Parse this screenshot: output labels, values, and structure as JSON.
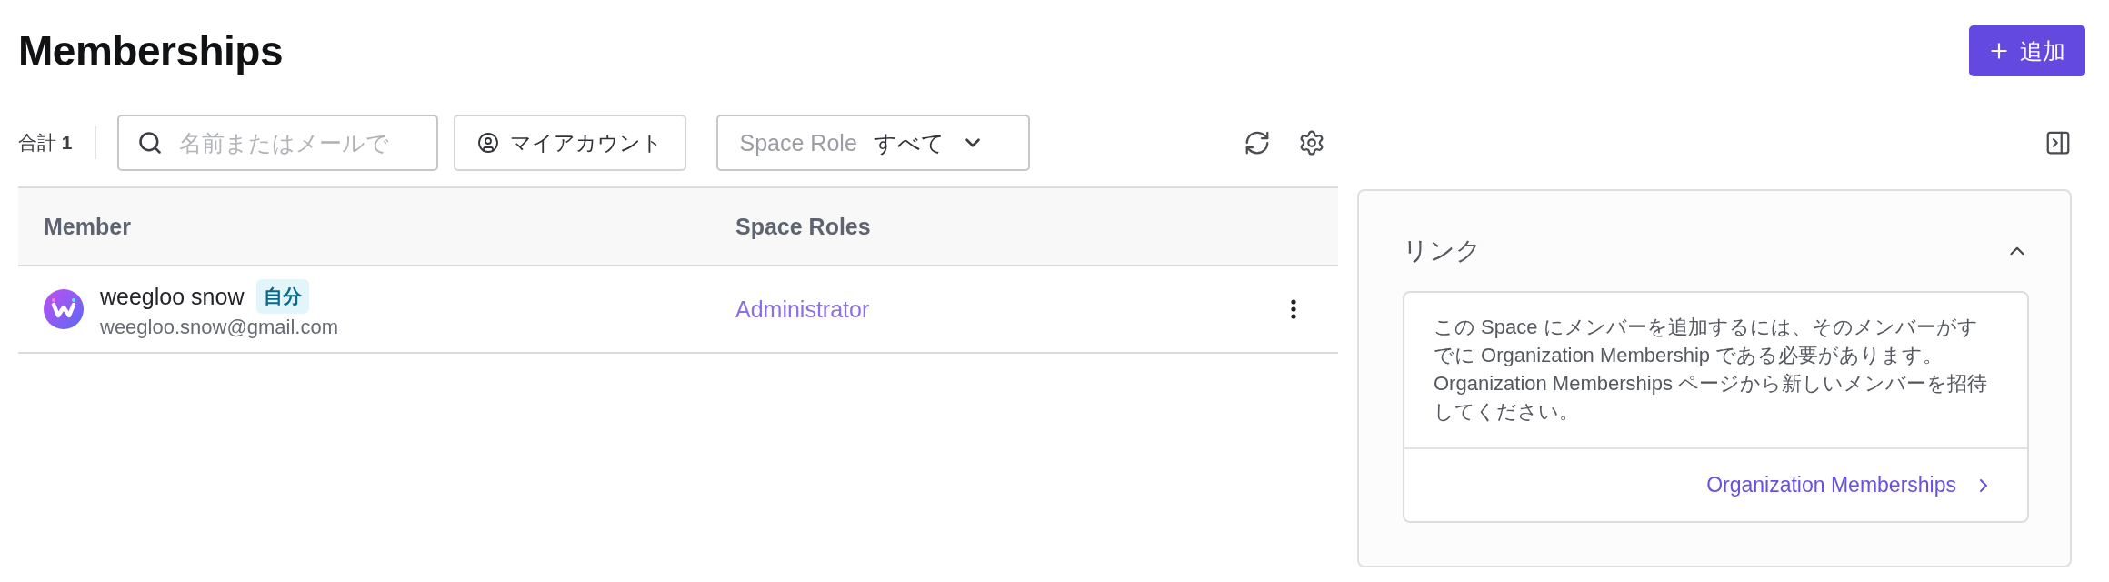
{
  "page": {
    "title": "Memberships",
    "add_button": "追加"
  },
  "toolbar": {
    "total": "合計 **1**",
    "search": {
      "placeholder": "名前またはメールで"
    },
    "my_account_button": "マイアカウント",
    "role_filter": {
      "label": "Space Role",
      "value": "すべて"
    }
  },
  "table": {
    "columns": [
      "Member",
      "Space Roles"
    ],
    "rows": [
      {
        "name": "weegloo snow",
        "badge": "自分",
        "email": "weegloo.snow@gmail.com",
        "role": "Administrator"
      }
    ]
  },
  "side_panel": {
    "title": "リンク",
    "expanded": true,
    "description": "この Space にメンバーを追加するには、そのメンバーがすでに Organization Membership である必要があります。Organization Memberships ページから新しいメンバーを招待してください。",
    "link": "Organization Memberships"
  }
}
